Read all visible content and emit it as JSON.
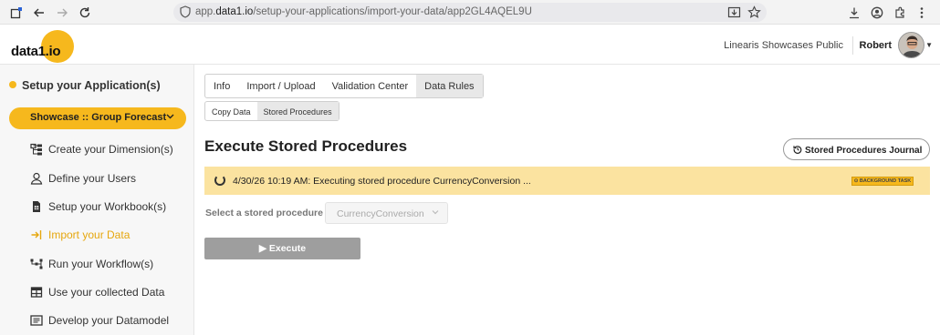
{
  "browser": {
    "url_prefix": "app.",
    "url_domain": "data1.io",
    "url_path": "/setup-your-applications/import-your-data/app2GL4AQEL9U"
  },
  "header": {
    "logo_text": "data1.io",
    "tenant": "Linearis Showcases Public",
    "user": "Robert"
  },
  "sidebar": {
    "title": "Setup your Application(s)",
    "showcase": "Showcase :: Group Forecast",
    "items": [
      {
        "label": "Create your Dimension(s)",
        "icon": "hierarchy-icon"
      },
      {
        "label": "Define your Users",
        "icon": "user-icon"
      },
      {
        "label": "Setup your Workbook(s)",
        "icon": "workbook-icon"
      },
      {
        "label": "Import your Data",
        "icon": "import-icon"
      },
      {
        "label": "Run your Workflow(s)",
        "icon": "workflow-icon"
      },
      {
        "label": "Use your collected Data",
        "icon": "table-icon"
      },
      {
        "label": "Develop your Datamodel",
        "icon": "datamodel-icon"
      }
    ]
  },
  "main": {
    "tabs": [
      "Info",
      "Import / Upload",
      "Validation Center",
      "Data Rules"
    ],
    "subtabs": [
      "Copy Data",
      "Stored Procedures"
    ],
    "title": "Execute Stored Procedures",
    "journal_button": "Stored Procedures Journal",
    "banner_message": "4/30/26 10:19 AM: Executing stored procedure CurrencyConversion ...",
    "badge": "BACKGROUND TASK",
    "select_label": "Select a stored procedure",
    "select_value": "CurrencyConversion",
    "execute_label": "Execute"
  },
  "colors": {
    "accent": "#f6b81d",
    "banner": "#fbe3a0",
    "active_item": "#e6a70e"
  }
}
